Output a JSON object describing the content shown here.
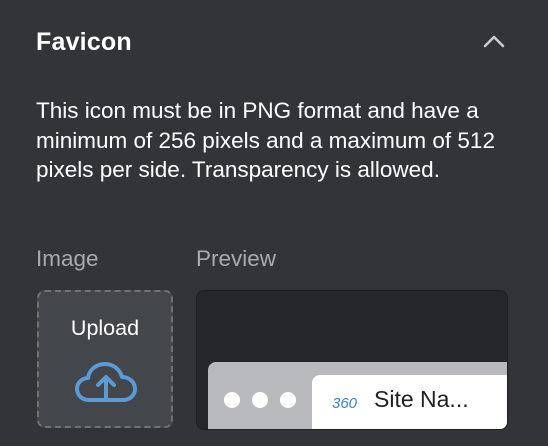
{
  "section": {
    "title": "Favicon",
    "collapse_icon": "chevron-up-icon"
  },
  "description": "This icon must be in PNG format and have a minimum of 256 pixels and a maximum of 512 pixels per side. Transparency is allowed.",
  "image": {
    "label": "Image",
    "upload_label": "Upload",
    "upload_icon": "cloud-upload-icon"
  },
  "preview": {
    "label": "Preview",
    "tab_title": "Site Na...",
    "favicon_text": "360"
  },
  "colors": {
    "background": "#323437",
    "accent": "#5b9bd5",
    "muted_text": "#a7aaaf",
    "upload_box": "#43464b",
    "preview_bg": "#26272a"
  }
}
